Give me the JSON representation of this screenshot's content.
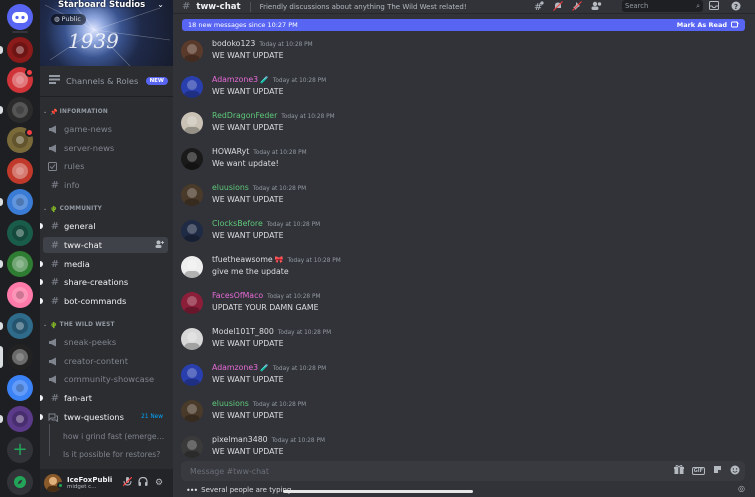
{
  "server_rail": {
    "servers": [
      {
        "name": "direct-messages",
        "color": "#5865f2"
      },
      {
        "name": "server-1",
        "color": "#8b1a1a"
      },
      {
        "name": "server-2",
        "color": "#d13438"
      },
      {
        "name": "server-3",
        "color": "#2b2b2b"
      },
      {
        "name": "server-4",
        "color": "#7a6a3a"
      },
      {
        "name": "server-5",
        "color": "#c0392b"
      },
      {
        "name": "server-6",
        "color": "#3a7bd5"
      },
      {
        "name": "server-7",
        "color": "#1a5c4a"
      },
      {
        "name": "server-8",
        "color": "#2e7d32"
      },
      {
        "name": "server-9",
        "color": "#ff7aa8"
      },
      {
        "name": "server-10",
        "color": "#2f6b8a"
      },
      {
        "name": "server-11",
        "color": "#222222"
      },
      {
        "name": "server-12",
        "color": "#3b82f6"
      },
      {
        "name": "server-13",
        "color": "#5b3a8a"
      }
    ],
    "add_icon": "plus-icon",
    "explore_icon": "compass-icon"
  },
  "server": {
    "name": "Starboard Studios",
    "visibility": "Public",
    "channels_roles_label": "Channels & Roles",
    "new_badge": "NEW"
  },
  "categories": [
    {
      "name": "INFORMATION",
      "emoji": "📌",
      "channels": [
        {
          "name": "game-news",
          "type": "announcement",
          "unread": false
        },
        {
          "name": "server-news",
          "type": "announcement",
          "unread": false
        },
        {
          "name": "rules",
          "type": "rules",
          "unread": false
        },
        {
          "name": "info",
          "type": "text",
          "unread": false
        }
      ]
    },
    {
      "name": "COMMUNITY",
      "emoji": "🌵",
      "channels": [
        {
          "name": "general",
          "type": "text",
          "unread": true
        },
        {
          "name": "tww-chat",
          "type": "text",
          "unread": true,
          "active": true
        },
        {
          "name": "media",
          "type": "text",
          "unread": true
        },
        {
          "name": "share-creations",
          "type": "text",
          "unread": true
        },
        {
          "name": "bot-commands",
          "type": "text",
          "unread": true
        }
      ]
    },
    {
      "name": "THE WILD WEST",
      "emoji": "🌵",
      "channels": [
        {
          "name": "sneak-peeks",
          "type": "announcement",
          "unread": false
        },
        {
          "name": "creator-content",
          "type": "announcement",
          "unread": false
        },
        {
          "name": "community-showcase",
          "type": "announcement",
          "unread": false
        },
        {
          "name": "fan-art",
          "type": "text",
          "unread": true
        },
        {
          "name": "tww-questions",
          "type": "forum",
          "unread": true,
          "badge": "21 New"
        }
      ],
      "threads": [
        "how i grind fast (emerge…",
        "Is it possible for restores?"
      ]
    }
  ],
  "user": {
    "name": "IceFoxPubli",
    "status": "midget c…",
    "avatar_color": "#8a5a2b"
  },
  "channel": {
    "name": "tww-chat",
    "topic": "Friendly discussions about anything The Wild West related!",
    "search_placeholder": "Search",
    "new_messages": "18 new messages since 10:27 PM",
    "mark_as_read": "Mark As Read",
    "composer_placeholder": "Message #tww-chat",
    "typing": "Several people are typing…"
  },
  "messages": [
    {
      "author": "bodoko123",
      "color": "#dbdee1",
      "time": "Today at 10:28 PM",
      "text": "WE WANT UPDATE",
      "avatar": "#5a3a2a"
    },
    {
      "author": "Adamzone3",
      "color": "#e86bd8",
      "time": "Today at 10:28 PM",
      "text": "WE WANT UPDATE",
      "avatar": "#2a3fae",
      "tag": "🧪"
    },
    {
      "author": "RedDragonFeder",
      "color": "#5fc97a",
      "time": "Today at 10:28 PM",
      "text": "WE WANT UPDATE",
      "avatar": "#c9c2b5"
    },
    {
      "author": "HOWARyt",
      "color": "#dbdee1",
      "time": "Today at 10:28 PM",
      "text": "We want update!",
      "avatar": "#1a1a1a"
    },
    {
      "author": "eluusions",
      "color": "#5fc97a",
      "time": "Today at 10:28 PM",
      "text": "WE WANT UPDATE",
      "avatar": "#4a3a2a"
    },
    {
      "author": "ClocksBefore",
      "color": "#5fc97a",
      "time": "Today at 10:28 PM",
      "text": "WE WANT UPDATE",
      "avatar": "#1f2a44"
    },
    {
      "author": "tfuetheawsome",
      "color": "#dbdee1",
      "time": "Today at 10:28 PM",
      "text": "give me the update",
      "avatar": "#eeeeee",
      "tag": "🎀"
    },
    {
      "author": "FacesOfMaco",
      "color": "#e86bd8",
      "time": "Today at 10:28 PM",
      "text": "UPDATE YOUR DAMN GAME",
      "avatar": "#8b1f3a"
    },
    {
      "author": "Model101T_800",
      "color": "#dbdee1",
      "time": "Today at 10:28 PM",
      "text": "WE WANT UPDATE",
      "avatar": "#d8d8d8"
    },
    {
      "author": "Adamzone3",
      "color": "#e86bd8",
      "time": "Today at 10:28 PM",
      "text": "WE WANT UPDATE",
      "avatar": "#2a3fae",
      "tag": "🧪"
    },
    {
      "author": "eluusions",
      "color": "#5fc97a",
      "time": "Today at 10:28 PM",
      "text": "WE WANT UPDATE",
      "avatar": "#4a3a2a"
    },
    {
      "author": "pixelman3480",
      "color": "#dbdee1",
      "time": "Today at 10:28 PM",
      "text": "WE WANT UPDATE",
      "avatar": "#3a3a3a"
    }
  ],
  "colors": {
    "accent": "#5865f2",
    "background": "#313338",
    "sidebar": "#2b2d31",
    "rail": "#1e1f22"
  }
}
